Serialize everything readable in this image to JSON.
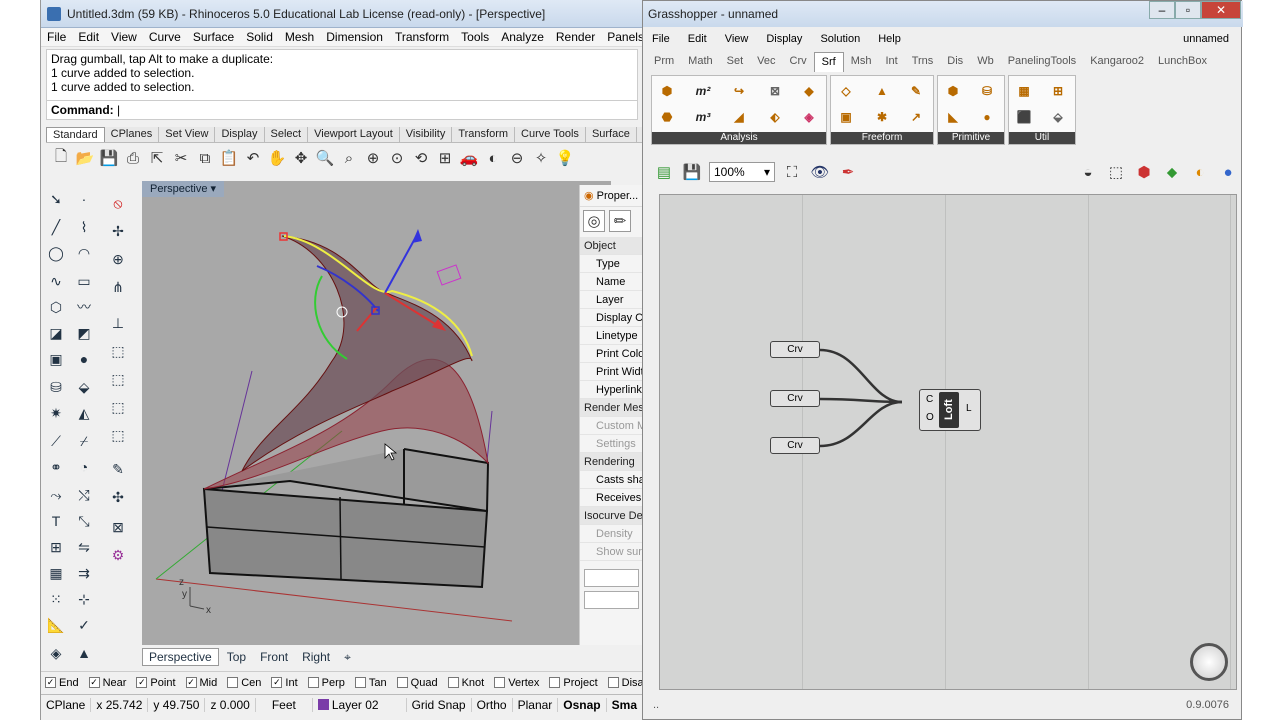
{
  "rhino": {
    "title": "Untitled.3dm (59 KB) - Rhinoceros 5.0 Educational Lab License (read-only) - [Perspective]",
    "menu": [
      "File",
      "Edit",
      "View",
      "Curve",
      "Surface",
      "Solid",
      "Mesh",
      "Dimension",
      "Transform",
      "Tools",
      "Analyze",
      "Render",
      "Panels",
      "H"
    ],
    "history": [
      "Drag gumball, tap Alt to make a duplicate:",
      "1 curve added to selection.",
      "1 curve added to selection."
    ],
    "command_label": "Command:",
    "toolbar_tabs": [
      "Standard",
      "CPlanes",
      "Set View",
      "Display",
      "Select",
      "Viewport Layout",
      "Visibility",
      "Transform",
      "Curve Tools",
      "Surface"
    ],
    "viewport_label": "Perspective",
    "viewport_tabs": [
      "Perspective",
      "Top",
      "Front",
      "Right",
      "⌖"
    ],
    "axes": {
      "x": "x",
      "y": "y",
      "z": "z"
    },
    "properties": {
      "tab": "Proper...",
      "rows": [
        {
          "t": "Object",
          "k": "sec"
        },
        {
          "t": "Type",
          "k": "ind"
        },
        {
          "t": "Name",
          "k": "ind"
        },
        {
          "t": "Layer",
          "k": "ind"
        },
        {
          "t": "Display Co",
          "k": "ind"
        },
        {
          "t": "Linetype",
          "k": "ind"
        },
        {
          "t": "Print Color",
          "k": "ind"
        },
        {
          "t": "Print Width",
          "k": "ind"
        },
        {
          "t": "Hyperlink",
          "k": "ind"
        },
        {
          "t": "Render Mes",
          "k": "sec"
        },
        {
          "t": "Custom Me",
          "k": "dim"
        },
        {
          "t": "Settings",
          "k": "dim"
        },
        {
          "t": "Rendering",
          "k": "sec"
        },
        {
          "t": "Casts shad",
          "k": "ind"
        },
        {
          "t": "Receives s",
          "k": "ind"
        },
        {
          "t": "Isocurve De",
          "k": "sec"
        },
        {
          "t": "Density",
          "k": "dim"
        },
        {
          "t": "Show surfa",
          "k": "dim"
        }
      ]
    },
    "osnaps": [
      {
        "label": "End",
        "on": true
      },
      {
        "label": "Near",
        "on": true
      },
      {
        "label": "Point",
        "on": true
      },
      {
        "label": "Mid",
        "on": true
      },
      {
        "label": "Cen",
        "on": false
      },
      {
        "label": "Int",
        "on": true
      },
      {
        "label": "Perp",
        "on": false
      },
      {
        "label": "Tan",
        "on": false
      },
      {
        "label": "Quad",
        "on": false
      },
      {
        "label": "Knot",
        "on": false
      },
      {
        "label": "Vertex",
        "on": false
      },
      {
        "label": "Project",
        "on": false
      },
      {
        "label": "Disable",
        "on": false
      }
    ],
    "status": {
      "cplane": "CPlane",
      "x": "x 25.742",
      "y": "y 49.750",
      "z": "z 0.000",
      "units": "Feet",
      "layer": "Layer 02",
      "toggles": [
        "Grid Snap",
        "Ortho",
        "Planar",
        "Osnap",
        "Sma"
      ]
    },
    "layer_color": "#7a3ca8"
  },
  "gh": {
    "title": "Grasshopper - unnamed",
    "menu": [
      "File",
      "Edit",
      "View",
      "Display",
      "Solution",
      "Help"
    ],
    "doc": "unnamed",
    "tabs": [
      "Prm",
      "Math",
      "Set",
      "Vec",
      "Crv",
      "Srf",
      "Msh",
      "Int",
      "Trns",
      "Dis",
      "Wb",
      "PanelingTools",
      "Kangaroo2",
      "LunchBox"
    ],
    "selected_tab": "Srf",
    "panels": [
      "Analysis",
      "Freeform",
      "Primitive",
      "Util"
    ],
    "zoom": "100%",
    "nodes": {
      "crv1": "Crv",
      "crv2": "Crv",
      "crv3": "Crv",
      "loft": "Loft",
      "in_c": "C",
      "in_o": "O",
      "out_l": "L"
    },
    "version": "0.9.0076"
  }
}
